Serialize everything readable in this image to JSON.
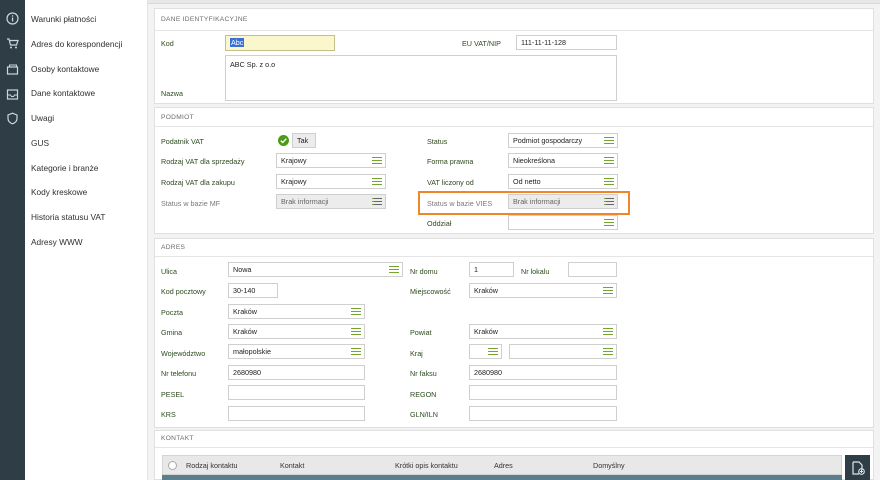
{
  "sidebar": {
    "items": [
      {
        "label": "Warunki płatności"
      },
      {
        "label": "Adres do korespondencji"
      },
      {
        "label": "Osoby kontaktowe"
      },
      {
        "label": "Dane kontaktowe"
      },
      {
        "label": "Uwagi"
      },
      {
        "label": "GUS"
      },
      {
        "label": "Kategorie i branże"
      },
      {
        "label": "Kody kreskowe"
      },
      {
        "label": "Historia statusu VAT"
      },
      {
        "label": "Adresy WWW"
      }
    ]
  },
  "dane": {
    "title": "DANE IDENTYFIKACYJNE",
    "kod_label": "Kod",
    "kod_value": "Abc",
    "euvat_label": "EU VAT/NIP",
    "euvat_value": "111-11-11-128",
    "nazwa_label": "Nazwa",
    "nazwa_value": "ABC Sp. z o.o"
  },
  "podmiot": {
    "title": "PODMIOT",
    "podatnik_label": "Podatnik VAT",
    "podatnik_value": "Tak",
    "rodzaj_sprzedaz_label": "Rodzaj VAT dla sprzedaży",
    "rodzaj_sprzedaz_value": "Krajowy",
    "rodzaj_zakup_label": "Rodzaj VAT dla zakupu",
    "rodzaj_zakup_value": "Krajowy",
    "status_mf_label": "Status w bazie MF",
    "status_mf_value": "Brak informacji",
    "status_label": "Status",
    "status_value": "Podmiot gospodarczy",
    "forma_label": "Forma prawna",
    "forma_value": "Nieokreślona",
    "vat_liczony_label": "VAT liczony od",
    "vat_liczony_value": "Od netto",
    "vies_label": "Status w bazie VIES",
    "vies_value": "Brak informacji",
    "oddzial_label": "Oddział",
    "oddzial_value": ""
  },
  "adres": {
    "title": "ADRES",
    "ulica_label": "Ulica",
    "ulica_value": "Nowa",
    "nr_domu_label": "Nr domu",
    "nr_domu_value": "1",
    "nr_lokalu_label": "Nr lokalu",
    "nr_lokalu_value": "",
    "kod_label": "Kod pocztowy",
    "kod_value": "30-140",
    "miejscowosc_label": "Miejscowość",
    "miejscowosc_value": "Kraków",
    "poczta_label": "Poczta",
    "poczta_value": "Kraków",
    "gmina_label": "Gmina",
    "gmina_value": "Kraków",
    "powiat_label": "Powiat",
    "powiat_value": "Kraków",
    "woj_label": "Województwo",
    "woj_value": "małopolskie",
    "kraj_label": "Kraj",
    "kraj_value": "",
    "tel_label": "Nr telefonu",
    "tel_value": "2680980",
    "faks_label": "Nr faksu",
    "faks_value": "2680980",
    "pesel_label": "PESEL",
    "pesel_value": "",
    "regon_label": "REGON",
    "regon_value": "",
    "krs_label": "KRS",
    "krs_value": "",
    "gln_label": "GLN/ILN",
    "gln_value": ""
  },
  "kontakt": {
    "title": "KONTAKT",
    "columns": [
      "Rodzaj kontaktu",
      "Kontakt",
      "Krótki opis kontaktu",
      "Adres",
      "Domyślny"
    ]
  },
  "colors": {
    "accent": "#73a72b",
    "highlight": "#f0862a",
    "rail": "#2e3d46"
  }
}
